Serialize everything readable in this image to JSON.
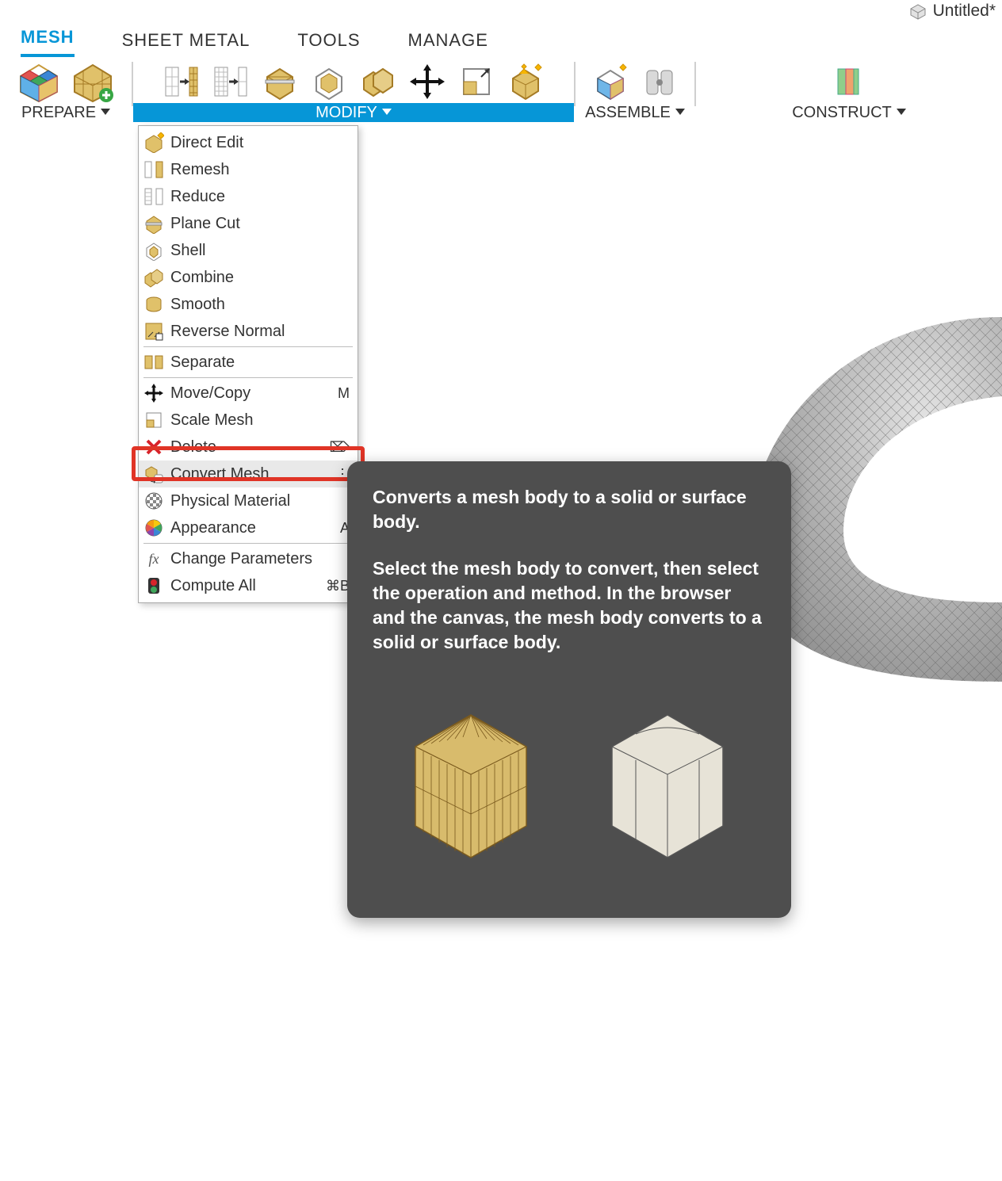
{
  "document": {
    "title": "Untitled*"
  },
  "tabs": [
    {
      "name": "mesh",
      "label": "MESH",
      "active": true
    },
    {
      "name": "sheet-metal",
      "label": "SHEET METAL"
    },
    {
      "name": "tools",
      "label": "TOOLS"
    },
    {
      "name": "manage",
      "label": "MANAGE"
    }
  ],
  "ribbon": {
    "prepare": {
      "label": "PREPARE"
    },
    "modify": {
      "label": "MODIFY"
    },
    "assemble": {
      "label": "ASSEMBLE"
    },
    "construct": {
      "label": "CONSTRUCT"
    }
  },
  "menu": {
    "items": [
      {
        "id": "direct-edit",
        "label": "Direct Edit"
      },
      {
        "id": "remesh",
        "label": "Remesh"
      },
      {
        "id": "reduce",
        "label": "Reduce"
      },
      {
        "id": "plane-cut",
        "label": "Plane Cut"
      },
      {
        "id": "shell",
        "label": "Shell"
      },
      {
        "id": "combine",
        "label": "Combine"
      },
      {
        "id": "smooth",
        "label": "Smooth"
      },
      {
        "id": "reverse-normal",
        "label": "Reverse Normal"
      },
      {
        "sep": true
      },
      {
        "id": "separate",
        "label": "Separate"
      },
      {
        "sep": true
      },
      {
        "id": "move-copy",
        "label": "Move/Copy",
        "accel": "M"
      },
      {
        "id": "scale-mesh",
        "label": "Scale Mesh"
      },
      {
        "id": "delete",
        "label": "Delete",
        "accel": "⌦"
      },
      {
        "id": "convert-mesh",
        "label": "Convert Mesh",
        "highlight": true,
        "more": true
      },
      {
        "id": "physical-material",
        "label": "Physical Material"
      },
      {
        "id": "appearance",
        "label": "Appearance",
        "accel": "A"
      },
      {
        "sep": true
      },
      {
        "id": "change-parameters",
        "label": "Change Parameters"
      },
      {
        "id": "compute-all",
        "label": "Compute All",
        "accel": "⌘B"
      }
    ]
  },
  "tooltip": {
    "title": "Converts a mesh body to a solid or surface body.",
    "description": "Select the mesh body to convert, then select the operation and method. In the browser and the canvas, the mesh body converts to a solid or surface body."
  }
}
